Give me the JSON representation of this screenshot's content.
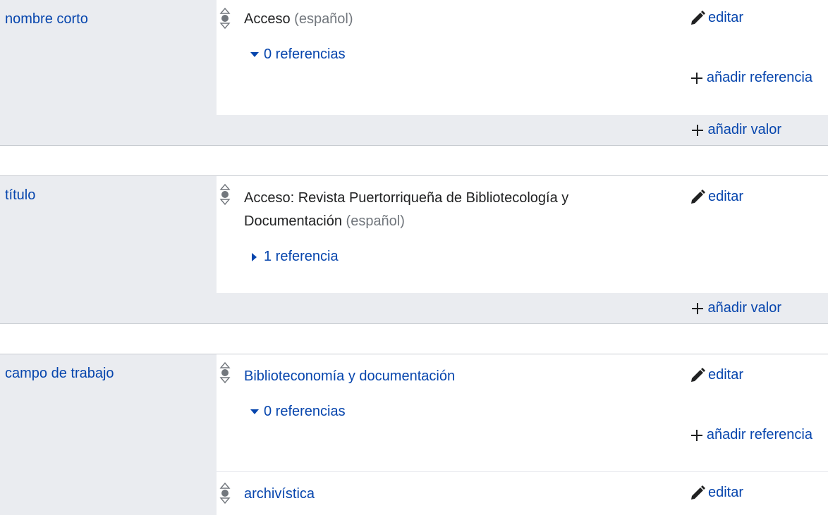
{
  "groups": [
    {
      "property": "nombre corto",
      "statements": [
        {
          "value": "Acceso",
          "lang": "(español)",
          "edit_label": "editar",
          "refs_label": "0 referencias",
          "refs_expanded": true,
          "add_ref_label": "añadir referencia"
        }
      ],
      "add_value_label": "añadir valor"
    },
    {
      "property": "título",
      "statements": [
        {
          "value": "Acceso: Revista Puertorriqueña de Bibliotecología y Documentación",
          "lang": "(español)",
          "edit_label": "editar",
          "refs_label": "1 referencia",
          "refs_expanded": false
        }
      ],
      "add_value_label": "añadir valor"
    },
    {
      "property": "campo de trabajo",
      "statements": [
        {
          "value": "Biblioteconomía y documentación",
          "edit_label": "editar",
          "refs_label": "0 referencias",
          "refs_expanded": true,
          "add_ref_label": "añadir referencia"
        },
        {
          "value": "archivística",
          "edit_label": "editar"
        }
      ]
    }
  ],
  "icons": {
    "rank": "normal-rank-icon",
    "edit": "pencil-icon",
    "add": "plus-icon",
    "expanded": "triangle-down-icon",
    "collapsed": "triangle-right-icon"
  },
  "colors": {
    "link": "#0645ad",
    "panel": "#eaecf0",
    "muted": "#72777d"
  }
}
